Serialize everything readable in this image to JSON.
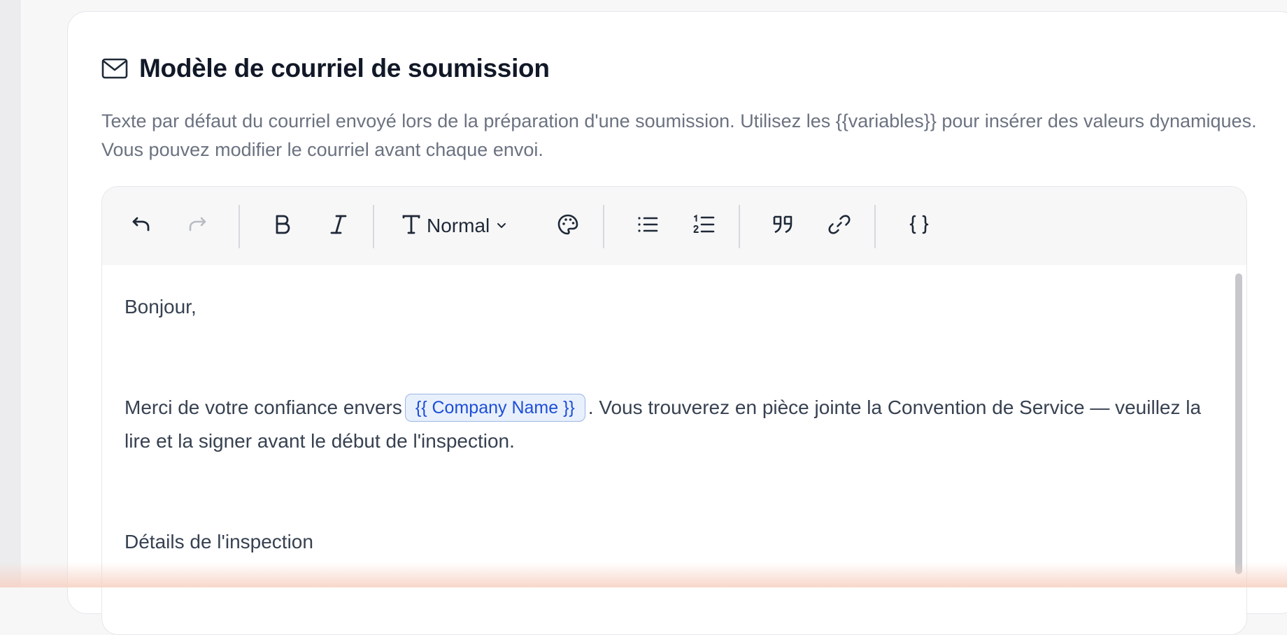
{
  "section": {
    "title": "Modèle de courriel de soumission",
    "description": "Texte par défaut du courriel envoyé lors de la préparation d'une soumission. Utilisez les {{variables}} pour insérer des valeurs dynamiques. Vous pouvez modifier le courriel avant chaque envoi."
  },
  "toolbar": {
    "text_style": "Normal",
    "icons": [
      "undo-icon",
      "redo-icon",
      "bold-icon",
      "italic-icon",
      "text-style-icon",
      "chevron-down-icon",
      "palette-icon",
      "bullet-list-icon",
      "numbered-list-icon",
      "quote-icon",
      "link-icon",
      "variable-braces-icon"
    ]
  },
  "editor": {
    "greeting": "Bonjour,",
    "para1_before": "Merci de votre confiance envers",
    "variable_chip": "{{ Company Name }}",
    "para1_after": ". Vous trouverez en pièce jointe la Convention de Service — veuillez la lire et la signer avant le début de l'inspection.",
    "section_heading": "Détails de l'inspection"
  },
  "colors": {
    "chip_bg": "#e8f0fc",
    "chip_text": "#1d4ed8",
    "muted_text": "#6b7280"
  }
}
